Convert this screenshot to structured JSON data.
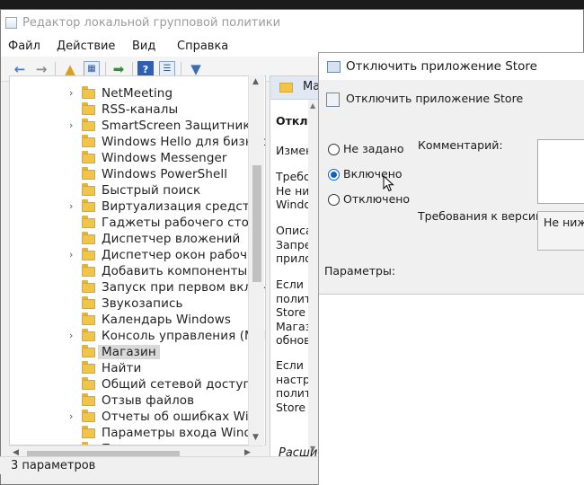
{
  "window": {
    "title": "Редактор локальной групповой политики"
  },
  "menu": [
    "Файл",
    "Действие",
    "Вид",
    "Справка"
  ],
  "toolbar": {
    "buttons": [
      "back-arrow-icon",
      "forward-arrow-icon",
      "up-folder-icon",
      "show-hide-tree-icon",
      "export-list-icon",
      "help-icon",
      "properties-icon",
      "filter-icon"
    ]
  },
  "tree": {
    "items": [
      {
        "label": "NetMeeting",
        "expandable": true
      },
      {
        "label": "RSS-каналы",
        "expandable": false
      },
      {
        "label": "SmartScreen Защитника",
        "expandable": true
      },
      {
        "label": "Windows Hello для бизнес",
        "expandable": false
      },
      {
        "label": "Windows Messenger",
        "expandable": false
      },
      {
        "label": "Windows PowerShell",
        "expandable": false
      },
      {
        "label": "Быстрый поиск",
        "expandable": false
      },
      {
        "label": "Виртуализация средстве",
        "expandable": true
      },
      {
        "label": "Гаджеты рабочего столо",
        "expandable": false
      },
      {
        "label": "Диспетчер вложений",
        "expandable": false
      },
      {
        "label": "Диспетчер окон рабочег",
        "expandable": true
      },
      {
        "label": "Добавить компоненты в",
        "expandable": false
      },
      {
        "label": "Запуск при первом включ",
        "expandable": false
      },
      {
        "label": "Звукозапись",
        "expandable": false
      },
      {
        "label": "Календарь Windows",
        "expandable": false
      },
      {
        "label": "Консоль управления (MM",
        "expandable": true
      },
      {
        "label": "Магазин",
        "expandable": false,
        "selected": true
      },
      {
        "label": "Найти",
        "expandable": false
      },
      {
        "label": "Общий сетевой доступ",
        "expandable": false
      },
      {
        "label": "Отзыв файлов",
        "expandable": false
      },
      {
        "label": "Отчеты об ошибках Win",
        "expandable": true
      },
      {
        "label": "Параметры входа Windo",
        "expandable": false
      },
      {
        "label": "П",
        "expandable": false
      }
    ]
  },
  "right_pane": {
    "header": "Ма",
    "policy_title": "Отключ",
    "edit_link": "Изменит",
    "req_text": "Требова\nНе ниже\nWindows",
    "desc_text": "Описани\nЗапреща\nприложе",
    "if_enabled": "Если вы\nполитику\nStore буд\nМагазину\nобновле",
    "if_disabled": "Если вы\nнастраив\nполитику\nStore буд",
    "tab": "Расши"
  },
  "status": {
    "text": "3 параметров"
  },
  "dialog": {
    "title": "Отключить приложение Store",
    "setting_name": "Отключить приложение Store",
    "options": [
      "Не задано",
      "Включено",
      "Отключено"
    ],
    "selected_option": "Включено",
    "comment_label": "Комментарий:",
    "requirements_label": "Требования к версии:",
    "requirements_value": "Не ниж",
    "parameters_label": "Параметры:"
  },
  "colors": {
    "accent": "#0a64c8",
    "folder": "#f0c548",
    "selection": "#d9d9d9"
  }
}
